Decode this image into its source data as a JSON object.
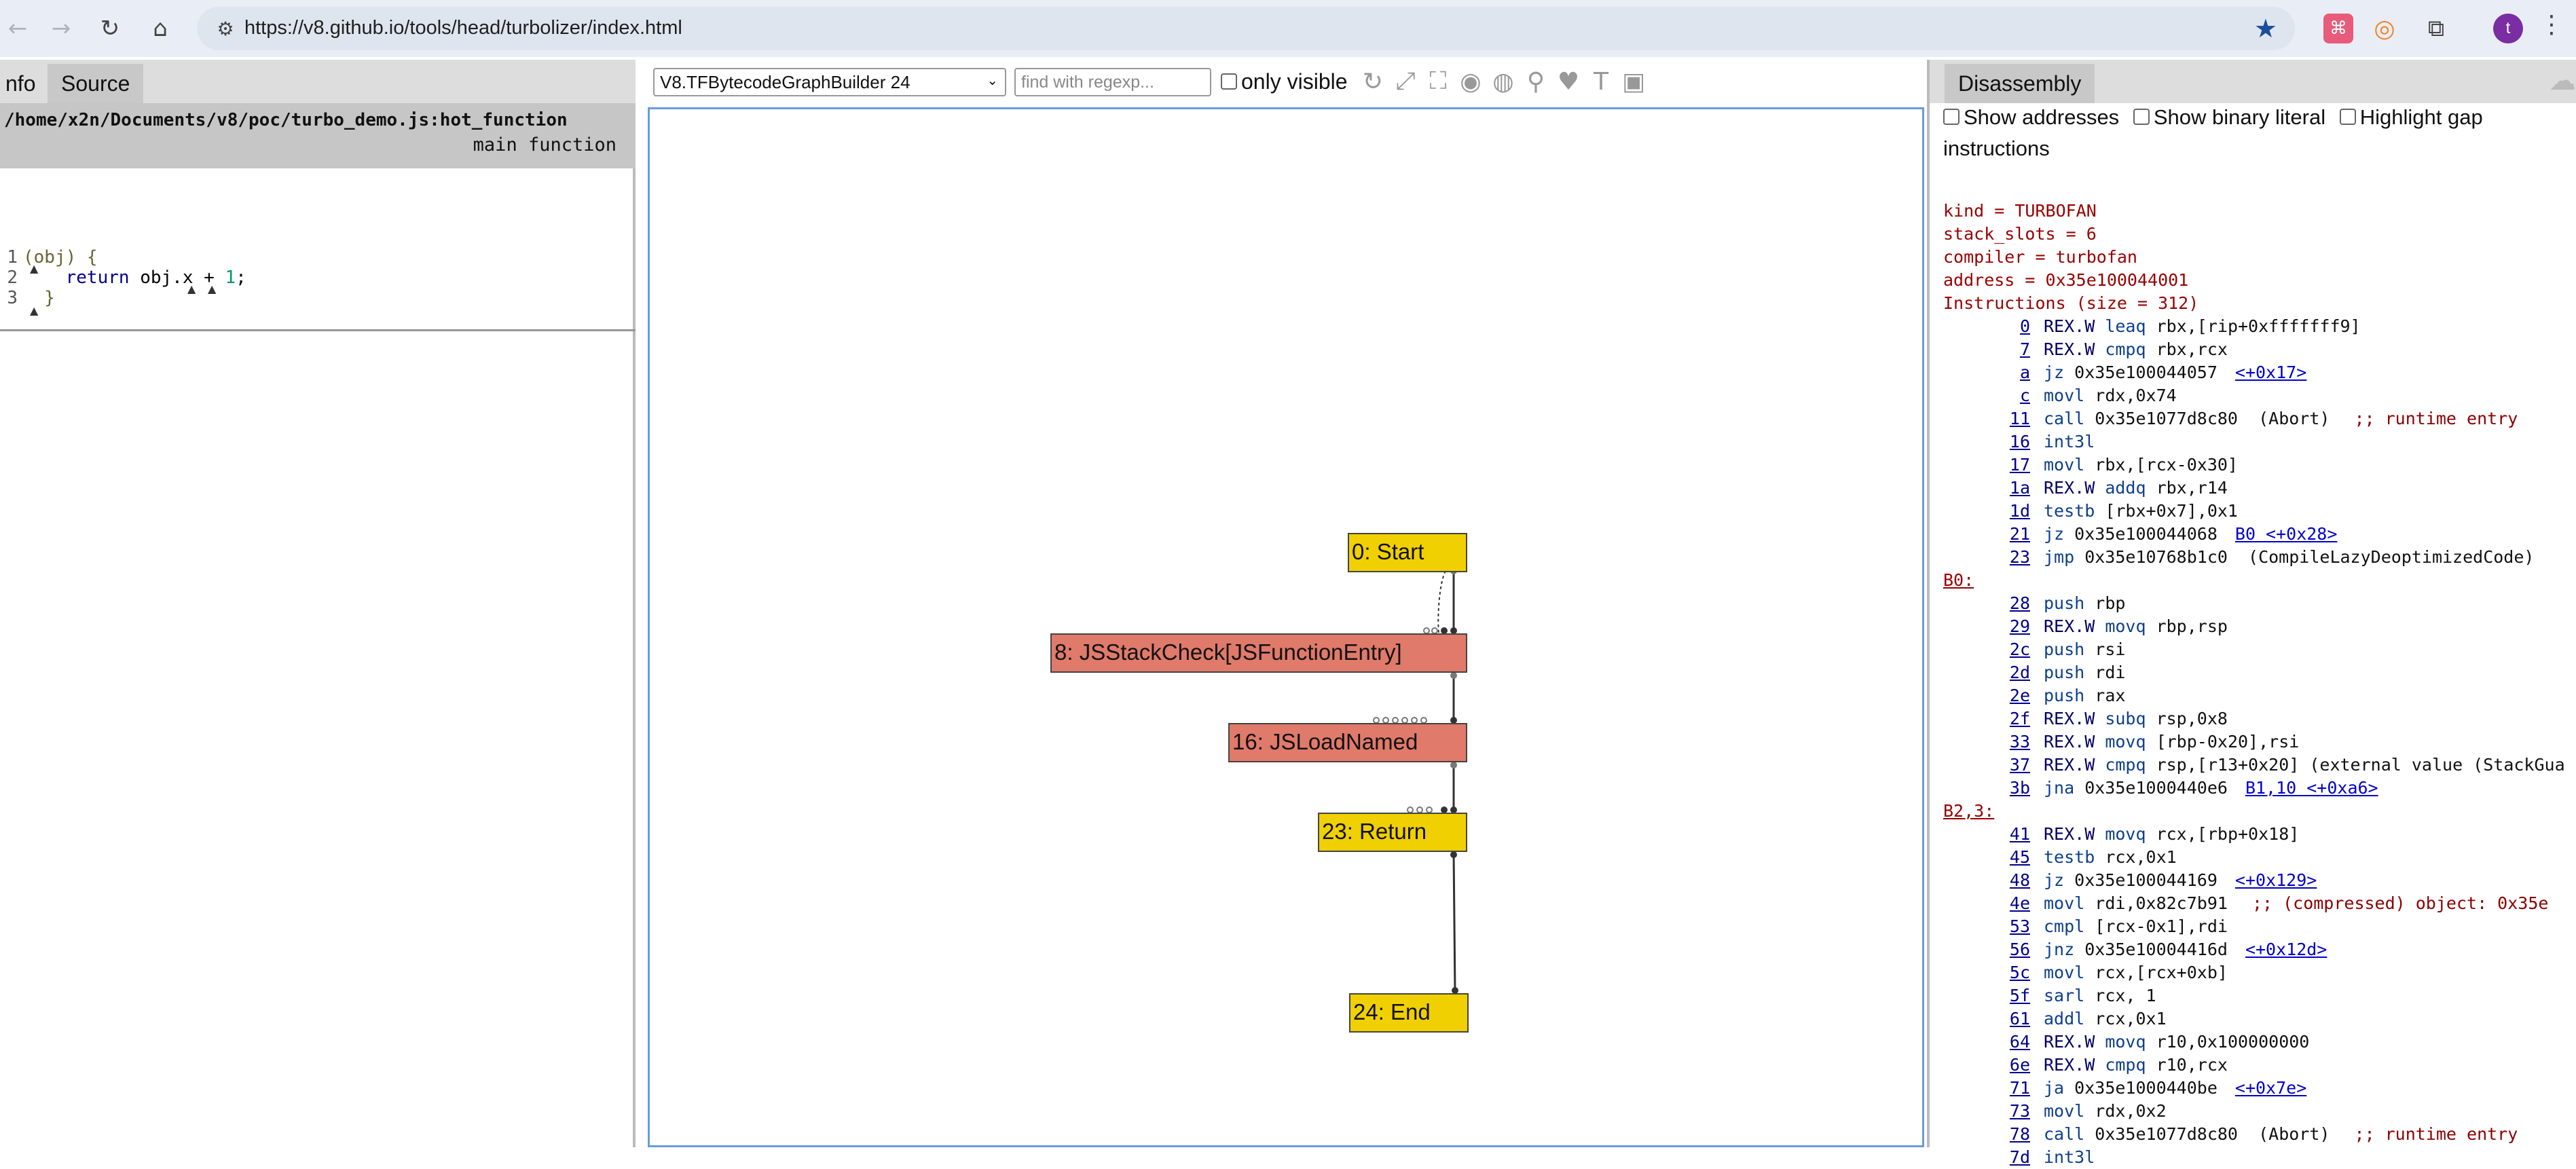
{
  "browser": {
    "url": "https://v8.github.io/tools/head/turbolizer/index.html",
    "avatar_letter": "t",
    "icons": {
      "back": "back-arrow-icon",
      "forward": "forward-arrow-icon",
      "reload": "reload-icon",
      "home": "home-icon",
      "site": "site-settings-icon",
      "bookmark": "star-icon",
      "extension_puzzle": "puzzle-icon",
      "menu": "more-vert-icon"
    }
  },
  "left": {
    "tabs": [
      "nfo",
      "Source"
    ],
    "source_path": "/home/x2n/Documents/v8/poc/turbo_demo.js:hot_function",
    "source_function": "main function",
    "code": [
      {
        "no": "1",
        "parts": [
          {
            "t": "(obj) {",
            "c": "punc"
          }
        ]
      },
      {
        "no": "2",
        "parts": [
          {
            "t": "    ",
            "c": ""
          },
          {
            "t": "return",
            "c": "kw"
          },
          {
            "t": " obj.x + ",
            "c": ""
          },
          {
            "t": "1",
            "c": "num"
          },
          {
            "t": ";",
            "c": ""
          }
        ]
      },
      {
        "no": "3",
        "parts": [
          {
            "t": "  }",
            "c": "punc"
          }
        ]
      }
    ]
  },
  "middle": {
    "phase_selected": "V8.TFBytecodeGraphBuilder 24",
    "regex_placeholder": "find with regexp...",
    "only_visible_label": "only visible",
    "toolbar_icons": [
      "layout-icon",
      "show-all-icon",
      "fit-icon",
      "toggle-hide-icon",
      "hide-selected-icon",
      "search-icon",
      "heart-icon",
      "types-icon",
      "save-icon"
    ],
    "nodes": [
      {
        "id": "start",
        "label": "0: Start",
        "kind": "yellow"
      },
      {
        "id": "stackcheck",
        "label": "8: JSStackCheck[JSFunctionEntry]",
        "kind": "red"
      },
      {
        "id": "loadnamed",
        "label": "16: JSLoadNamed",
        "kind": "red"
      },
      {
        "id": "return",
        "label": "23: Return",
        "kind": "yellow"
      },
      {
        "id": "end",
        "label": "24: End",
        "kind": "yellow"
      }
    ]
  },
  "right": {
    "tab": "Disassembly",
    "options": [
      "Show addresses",
      "Show binary literal",
      "Highlight gap",
      "instructions"
    ],
    "header_lines": [
      "kind = TURBOFAN",
      "stack_slots = 6",
      "compiler = turbofan",
      "address = 0x35e100044001",
      "Instructions (size = 312)"
    ],
    "lines": [
      {
        "off": "0",
        "rex": "REX.W",
        "mn": "leaq",
        "args": "rbx,[rip+0xfffffff9]"
      },
      {
        "off": "7",
        "rex": "REX.W",
        "mn": "cmpq",
        "args": "rbx,rcx"
      },
      {
        "off": "a",
        "mn": "jz",
        "args": "0x35e100044057",
        "link": "<+0x17>"
      },
      {
        "off": "c",
        "mn": "movl",
        "args": "rdx,0x74"
      },
      {
        "off": "11",
        "mn": "call",
        "args": "0x35e1077d8c80  (Abort)",
        "cmt": ";; runtime entry"
      },
      {
        "off": "16",
        "mn": "int3l",
        "args": ""
      },
      {
        "off": "17",
        "mn": "movl",
        "args": "rbx,[rcx-0x30]"
      },
      {
        "off": "1a",
        "rex": "REX.W",
        "mn": "addq",
        "args": "rbx,r14"
      },
      {
        "off": "1d",
        "mn": "testb",
        "args": "[rbx+0x7],0x1"
      },
      {
        "off": "21",
        "mn": "jz",
        "args": "0x35e100044068",
        "link": "B0 <+0x28>"
      },
      {
        "off": "23",
        "mn": "jmp",
        "args": "0x35e10768b1c0  (CompileLazyDeoptimizedCode)"
      },
      {
        "block": "B0:"
      },
      {
        "off": "28",
        "mn": "push",
        "args": "rbp"
      },
      {
        "off": "29",
        "rex": "REX.W",
        "mn": "movq",
        "args": "rbp,rsp"
      },
      {
        "off": "2c",
        "mn": "push",
        "args": "rsi"
      },
      {
        "off": "2d",
        "mn": "push",
        "args": "rdi"
      },
      {
        "off": "2e",
        "mn": "push",
        "args": "rax"
      },
      {
        "off": "2f",
        "rex": "REX.W",
        "mn": "subq",
        "args": "rsp,0x8"
      },
      {
        "off": "33",
        "rex": "REX.W",
        "mn": "movq",
        "args": "[rbp-0x20],rsi"
      },
      {
        "off": "37",
        "rex": "REX.W",
        "mn": "cmpq",
        "args": "rsp,[r13+0x20] (external value (StackGua"
      },
      {
        "off": "3b",
        "mn": "jna",
        "args": "0x35e1000440e6",
        "link": "B1,10 <+0xa6>"
      },
      {
        "block": "B2,3:"
      },
      {
        "off": "41",
        "rex": "REX.W",
        "mn": "movq",
        "args": "rcx,[rbp+0x18]"
      },
      {
        "off": "45",
        "mn": "testb",
        "args": "rcx,0x1"
      },
      {
        "off": "48",
        "mn": "jz",
        "args": "0x35e100044169",
        "link": "<+0x129>"
      },
      {
        "off": "4e",
        "mn": "movl",
        "args": "rdi,0x82c7b91",
        "cmt": ";; (compressed) object: 0x35e"
      },
      {
        "off": "53",
        "mn": "cmpl",
        "args": "[rcx-0x1],rdi"
      },
      {
        "off": "56",
        "mn": "jnz",
        "args": "0x35e10004416d",
        "link": "<+0x12d>"
      },
      {
        "off": "5c",
        "mn": "movl",
        "args": "rcx,[rcx+0xb]"
      },
      {
        "off": "5f",
        "mn": "sarl",
        "args": "rcx, 1"
      },
      {
        "off": "61",
        "mn": "addl",
        "args": "rcx,0x1"
      },
      {
        "off": "64",
        "rex": "REX.W",
        "mn": "movq",
        "args": "r10,0x100000000"
      },
      {
        "off": "6e",
        "rex": "REX.W",
        "mn": "cmpq",
        "args": "r10,rcx"
      },
      {
        "off": "71",
        "mn": "ja",
        "args": "0x35e1000440be",
        "link": "<+0x7e>"
      },
      {
        "off": "73",
        "mn": "movl",
        "args": "rdx,0x2"
      },
      {
        "off": "78",
        "mn": "call",
        "args": "0x35e1077d8c80  (Abort)",
        "cmt": ";; runtime entry"
      },
      {
        "off": "7d",
        "mn": "int3l",
        "args": ""
      }
    ]
  }
}
